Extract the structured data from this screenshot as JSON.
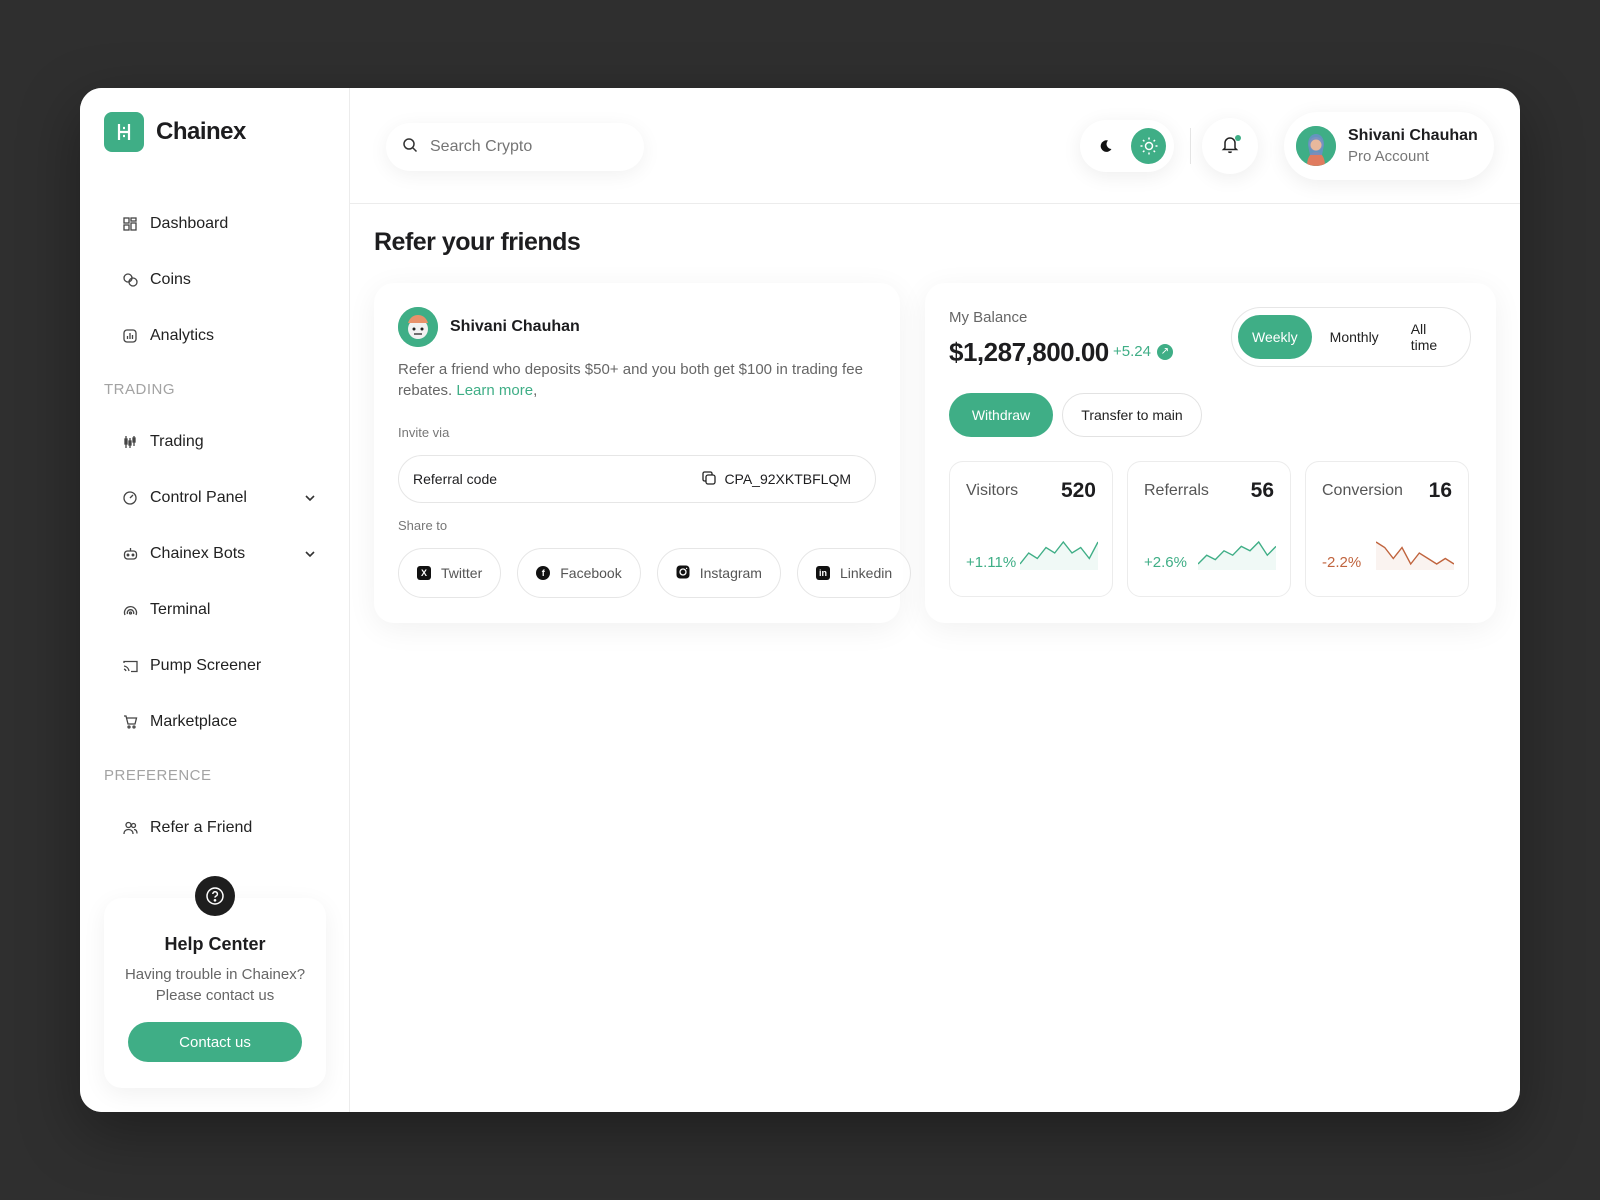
{
  "app": {
    "name": "Chainex"
  },
  "sidebar": {
    "items": [
      {
        "label": "Dashboard",
        "icon": "dashboard-icon"
      },
      {
        "label": "Coins",
        "icon": "coins-icon"
      },
      {
        "label": "Analytics",
        "icon": "analytics-icon"
      }
    ],
    "trading_section": "TRADING",
    "trading_items": [
      {
        "label": "Trading",
        "icon": "candles-icon"
      },
      {
        "label": "Control Panel",
        "icon": "gauge-icon",
        "expandable": true
      },
      {
        "label": "Chainex Bots",
        "icon": "bot-icon",
        "expandable": true
      },
      {
        "label": "Terminal",
        "icon": "signal-icon"
      },
      {
        "label": "Pump Screener",
        "icon": "cast-icon"
      },
      {
        "label": "Marketplace",
        "icon": "cart-icon"
      }
    ],
    "preference_section": "PREFERENCE",
    "preference_items": [
      {
        "label": "Refer a Friend",
        "icon": "users-icon"
      }
    ],
    "help": {
      "title": "Help Center",
      "text": "Having trouble in Chainex? Please contact us",
      "button": "Contact us"
    }
  },
  "topbar": {
    "search_placeholder": "Search Crypto",
    "theme": "light",
    "user": {
      "name": "Shivani Chauhan",
      "subtitle": "Pro Account"
    }
  },
  "page": {
    "title": "Refer your friends"
  },
  "referral": {
    "user_name": "Shivani Chauhan",
    "description": "Refer a friend who deposits $50+ and you both get $100 in trading fee rebates.",
    "learn_more": "Learn more",
    "learn_more_suffix": ",",
    "invite_label": "Invite via",
    "code_label": "Referral code",
    "code_value": "CPA_92XKTBFLQM",
    "share_label": "Share to",
    "share": [
      {
        "label": "Twitter",
        "icon": "x-icon"
      },
      {
        "label": "Facebook",
        "icon": "facebook-icon"
      },
      {
        "label": "Instagram",
        "icon": "instagram-icon"
      },
      {
        "label": "Linkedin",
        "icon": "linkedin-icon"
      }
    ]
  },
  "balance": {
    "label": "My Balance",
    "amount": "$1,287,800.00",
    "change": "+5.24",
    "periods": [
      "Weekly",
      "Monthly",
      "All time"
    ],
    "active_period": "Weekly",
    "withdraw": "Withdraw",
    "transfer": "Transfer to main",
    "stats": [
      {
        "label": "Visitors",
        "value": "520",
        "delta": "+1.11%",
        "trend": "up",
        "color": "#3fae86",
        "spark": [
          3,
          5,
          4,
          6,
          5,
          7,
          5,
          6,
          4,
          7
        ]
      },
      {
        "label": "Referrals",
        "value": "56",
        "delta": "+2.6%",
        "trend": "up",
        "color": "#3fae86",
        "spark": [
          2,
          4,
          3,
          5,
          4,
          6,
          5,
          7,
          4,
          6
        ]
      },
      {
        "label": "Conversion",
        "value": "16",
        "delta": "-2.2%",
        "trend": "down",
        "color": "#c0643e",
        "spark": [
          7,
          6,
          4,
          6,
          3,
          5,
          4,
          3,
          4,
          3
        ]
      }
    ]
  },
  "colors": {
    "accent": "#3fae86",
    "negative": "#c0643e"
  }
}
